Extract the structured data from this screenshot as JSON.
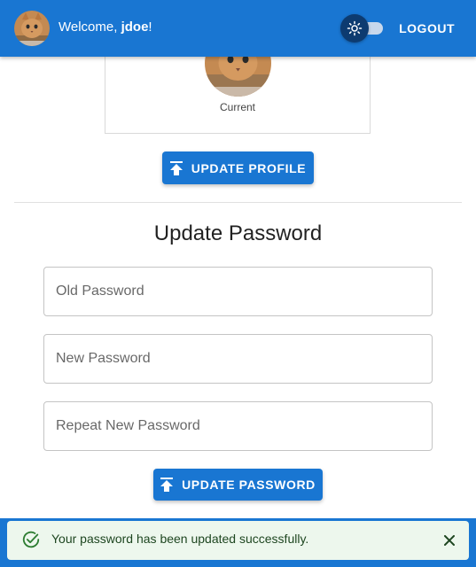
{
  "header": {
    "welcome_prefix": "Welcome, ",
    "username": "jdoe",
    "welcome_suffix": "!",
    "logout_label": "LOGOUT",
    "theme_toggle_icon": "sun-icon",
    "avatar_icon": "cat-avatar",
    "background": "#1976d2"
  },
  "profile": {
    "picture_caption": "Current",
    "update_button_label": "UPDATE PROFILE",
    "update_button_icon": "upload-icon"
  },
  "password": {
    "title": "Update Password",
    "old_placeholder": "Old Password",
    "new_placeholder": "New Password",
    "repeat_placeholder": "Repeat New Password",
    "update_button_label": "UPDATE PASSWORD",
    "update_button_icon": "upload-icon"
  },
  "snackbar": {
    "message": "Your password has been updated successfully.",
    "severity": "success",
    "icon": "check-circle-icon",
    "close_icon": "close-icon",
    "background": "#edf7ed"
  },
  "colors": {
    "primary": "#1976d2",
    "success": "#2e7d32"
  }
}
